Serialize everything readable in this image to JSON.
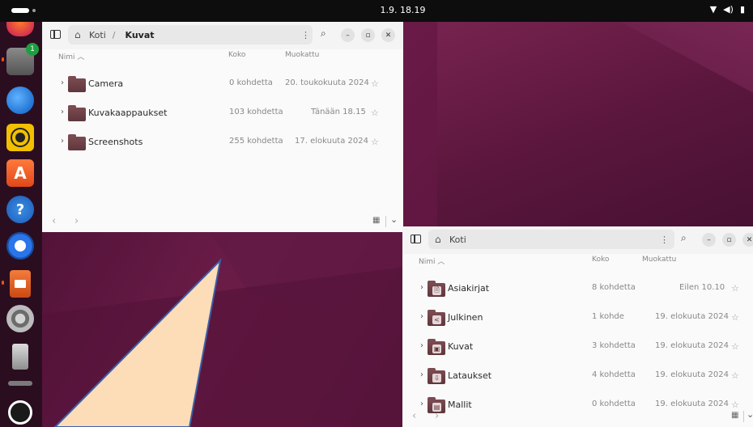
{
  "topbar": {
    "clock": "1.9.  18.19",
    "wifi_icon": "wifi-icon",
    "volume_icon": "volume-icon",
    "battery_icon": "battery-icon"
  },
  "dock": {
    "files_badge": "1",
    "help_glyph": "?",
    "appcenter_glyph": "A"
  },
  "window_kuvat": {
    "path": {
      "home": "Koti",
      "separator": "/",
      "current": "Kuvat"
    },
    "columns": {
      "name": "Nimi",
      "sort_indicator": "︿",
      "size": "Koko",
      "modified": "Muokattu"
    },
    "rows": [
      {
        "name": "Camera",
        "size": "0 kohdetta",
        "modified": "20. toukokuuta 2024"
      },
      {
        "name": "Kuvakaappaukset",
        "size": "103 kohdetta",
        "modified": "Tänään 18.15"
      },
      {
        "name": "Screenshots",
        "size": "255 kohdetta",
        "modified": "17. elokuuta 2024"
      }
    ]
  },
  "window_koti": {
    "path": {
      "home": "Koti"
    },
    "columns": {
      "name": "Nimi",
      "sort_indicator": "︿",
      "size": "Koko",
      "modified": "Muokattu"
    },
    "rows": [
      {
        "name": "Asiakirjat",
        "size": "8 kohdetta",
        "modified": "Eilen 10.10",
        "glyph": "🗎"
      },
      {
        "name": "Julkinen",
        "size": "1 kohde",
        "modified": "19. elokuuta 2024",
        "glyph": "<"
      },
      {
        "name": "Kuvat",
        "size": "3 kohdetta",
        "modified": "19. elokuuta 2024",
        "glyph": "▣"
      },
      {
        "name": "Lataukset",
        "size": "4 kohdetta",
        "modified": "19. elokuuta 2024",
        "glyph": "⇩"
      },
      {
        "name": "Mallit",
        "size": "0 kohdetta",
        "modified": "19. elokuuta 2024",
        "glyph": "▤"
      }
    ]
  },
  "shape": {
    "fill": "#fddcb8",
    "stroke": "#3c5fa8"
  }
}
